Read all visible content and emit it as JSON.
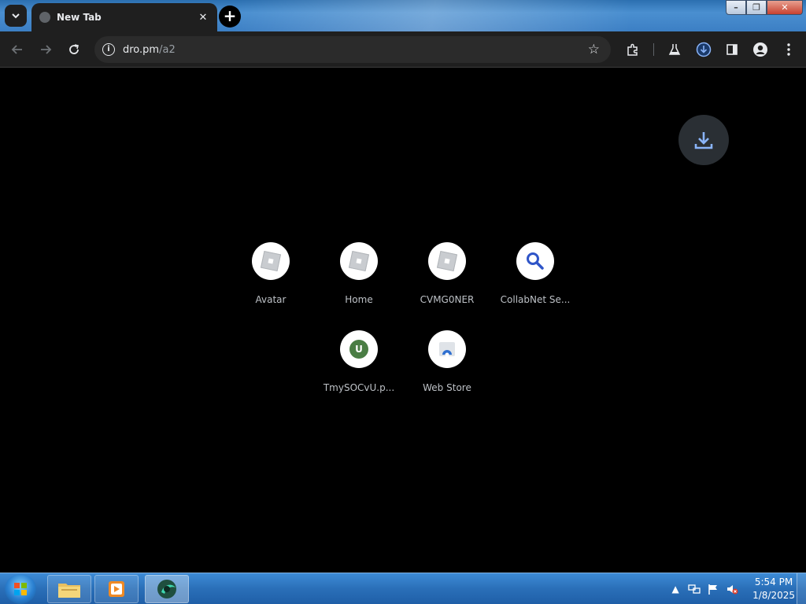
{
  "window": {
    "minimize_glyph": "–",
    "maximize_glyph": "❐",
    "close_glyph": "✕"
  },
  "tabs": [
    {
      "title": "New Tab",
      "close_glyph": "✕"
    }
  ],
  "new_tab_glyph": "+",
  "toolbar": {
    "back_icon": "arrow-left-icon",
    "forward_icon": "arrow-right-icon",
    "reload_icon": "reload-icon",
    "extensions_icon": "puzzle-icon",
    "labs_icon": "flask-icon",
    "downloads_icon": "download-icon",
    "side_panel_icon": "side-panel-icon",
    "profile_icon": "profile-icon",
    "menu_icon": "kebab-menu-icon"
  },
  "omnibox": {
    "info_glyph": "i",
    "url_host": "dro.pm",
    "url_path": "/a2",
    "star_glyph": "☆"
  },
  "shortcuts": [
    {
      "label": "Avatar",
      "icon": "roblox-icon"
    },
    {
      "label": "Home",
      "icon": "roblox-icon"
    },
    {
      "label": "CVMG0NER",
      "icon": "roblox-icon"
    },
    {
      "label": "CollabNet Se...",
      "icon": "search-icon"
    },
    {
      "label": "TmySOCvU.p...",
      "icon": "u-badge-icon",
      "badge_text": "U"
    },
    {
      "label": "Web Store",
      "icon": "web-store-icon"
    }
  ],
  "taskbar": {
    "pinned": [
      "explorer-icon",
      "media-player-icon",
      "browser-icon"
    ],
    "clock_time": "5:54 PM",
    "clock_date": "1/8/2025",
    "tray_arrow": "▲"
  },
  "colors": {
    "page_bg": "#000000",
    "toolbar_bg": "#1f1f1f",
    "accent_blue": "#8ab4f8",
    "badge_green": "#4a7d44"
  }
}
